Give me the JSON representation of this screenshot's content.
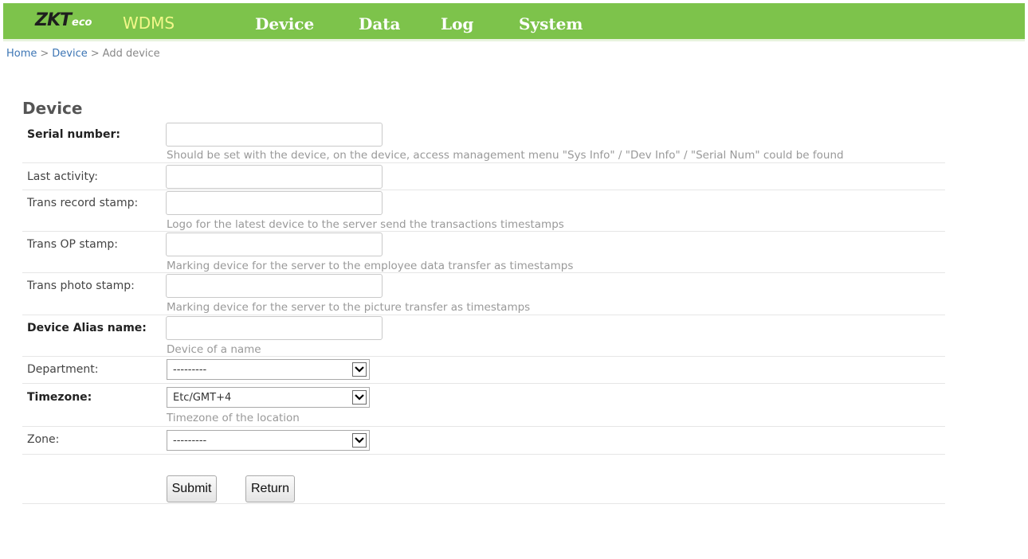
{
  "header": {
    "logo_main": "ZKT",
    "logo_sub": "eco",
    "app_name": "WDMS",
    "nav": {
      "device": "Device",
      "data": "Data",
      "log": "Log",
      "system": "System"
    }
  },
  "breadcrumb": {
    "home": "Home",
    "sep1": ">",
    "device": "Device",
    "sep2": ">",
    "current": "Add device"
  },
  "form": {
    "title": "Device",
    "serial_number": {
      "label": "Serial number:",
      "value": "",
      "help": "Should be set with the device, on the device, access management menu \"Sys Info\" / \"Dev Info\" / \"Serial Num\" could be found"
    },
    "last_activity": {
      "label": "Last activity:",
      "value": ""
    },
    "trans_record_stamp": {
      "label": "Trans record stamp:",
      "value": "",
      "help": "Logo for the latest device to the server send the transactions timestamps"
    },
    "trans_op_stamp": {
      "label": "Trans OP stamp:",
      "value": "",
      "help": "Marking device for the server to the employee data transfer as timestamps"
    },
    "trans_photo_stamp": {
      "label": "Trans photo stamp:",
      "value": "",
      "help": "Marking device for the server to the picture transfer as timestamps"
    },
    "device_alias": {
      "label": "Device Alias name:",
      "value": "",
      "help": "Device of a name"
    },
    "department": {
      "label": "Department:",
      "selected": "---------"
    },
    "timezone": {
      "label": "Timezone:",
      "selected": "Etc/GMT+4",
      "help": "Timezone of the location"
    },
    "zone": {
      "label": "Zone:",
      "selected": "---------"
    },
    "buttons": {
      "submit": "Submit",
      "return": "Return"
    }
  },
  "icons": {
    "dropdown": "chevron-down-icon"
  }
}
